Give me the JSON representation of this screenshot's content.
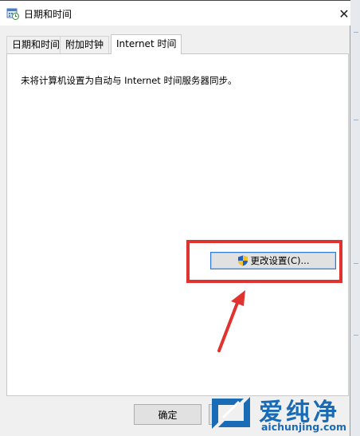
{
  "window": {
    "title": "日期和时间",
    "close_glyph": "✕"
  },
  "tabs": [
    {
      "label": "日期和时间",
      "active": false
    },
    {
      "label": "附加时钟",
      "active": false
    },
    {
      "label": "Internet 时间",
      "active": true
    }
  ],
  "internet_time": {
    "status": "未将计算机设置为自动与 Internet 时间服务器同步。",
    "change_settings_label": "更改设置(C)..."
  },
  "footer": {
    "ok_label": "确定"
  },
  "watermark": {
    "brand_cn": "爱纯净",
    "brand_url": "aichunjing.com"
  },
  "icons": {
    "title": "calendar-clock-icon",
    "change_settings": "uac-shield-icon",
    "close": "close-icon"
  },
  "colors": {
    "highlight": "#e0332f",
    "button_focus": "#2f7ad8",
    "watermark": "#1a6bb5"
  }
}
